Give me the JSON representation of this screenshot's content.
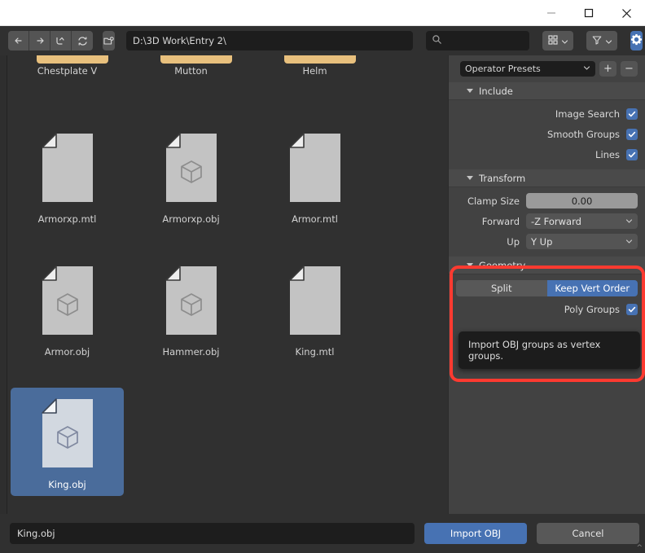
{
  "titlebar": {
    "minimize_label": "Minimize",
    "maximize_label": "Maximize",
    "close_label": "Close"
  },
  "toolbar": {
    "back_label": "Back",
    "forward_label": "Forward",
    "up_label": "Parent Directory",
    "refresh_label": "Refresh",
    "newfolder_label": "Create New Directory",
    "path_value": "D:\\3D Work\\Entry 2\\",
    "search_value": "",
    "search_placeholder": "",
    "display_mode_label": "Display Mode",
    "filter_label": "Filter",
    "settings_label": "Settings",
    "accent_color": "#4772b3"
  },
  "files": {
    "folders": [
      {
        "name": "Chestplate V",
        "type": "folder"
      },
      {
        "name": "Mutton",
        "type": "folder"
      },
      {
        "name": "Helm",
        "type": "folder"
      }
    ],
    "items": [
      {
        "name": "Armorxp.mtl",
        "type": "mtl",
        "selected": false
      },
      {
        "name": "Armorxp.obj",
        "type": "obj",
        "selected": false
      },
      {
        "name": "Armor.mtl",
        "type": "mtl",
        "selected": false
      },
      {
        "name": "Armor.obj",
        "type": "obj",
        "selected": false
      },
      {
        "name": "Hammer.obj",
        "type": "obj",
        "selected": false
      },
      {
        "name": "King.mtl",
        "type": "mtl",
        "selected": false
      },
      {
        "name": "King.obj",
        "type": "obj",
        "selected": true
      }
    ],
    "selection_color": "#4a6c9b",
    "folder_color": "#e8c07d"
  },
  "properties": {
    "preset": {
      "label": "Operator Presets",
      "add_label": "+",
      "remove_label": "−"
    },
    "include": {
      "title": "Include",
      "rows": [
        {
          "label": "Image Search",
          "checked": true
        },
        {
          "label": "Smooth Groups",
          "checked": true
        },
        {
          "label": "Lines",
          "checked": true
        }
      ]
    },
    "transform": {
      "title": "Transform",
      "clamp_size_label": "Clamp Size",
      "clamp_size_value": "0.00",
      "forward_label": "Forward",
      "forward_value": "-Z Forward",
      "up_label": "Up",
      "up_value": "Y Up"
    },
    "geometry": {
      "title": "Geometry",
      "split_label": "Split",
      "keep_vert_order_label": "Keep Vert Order",
      "active_toggle": "Keep Vert Order",
      "poly_groups_label": "Poly Groups",
      "poly_groups_checked": true,
      "tooltip": "Import OBJ groups as vertex groups.",
      "highlight_color": "#fd3a30"
    }
  },
  "bottom": {
    "filename_value": "King.obj",
    "import_label": "Import OBJ",
    "cancel_label": "Cancel"
  }
}
